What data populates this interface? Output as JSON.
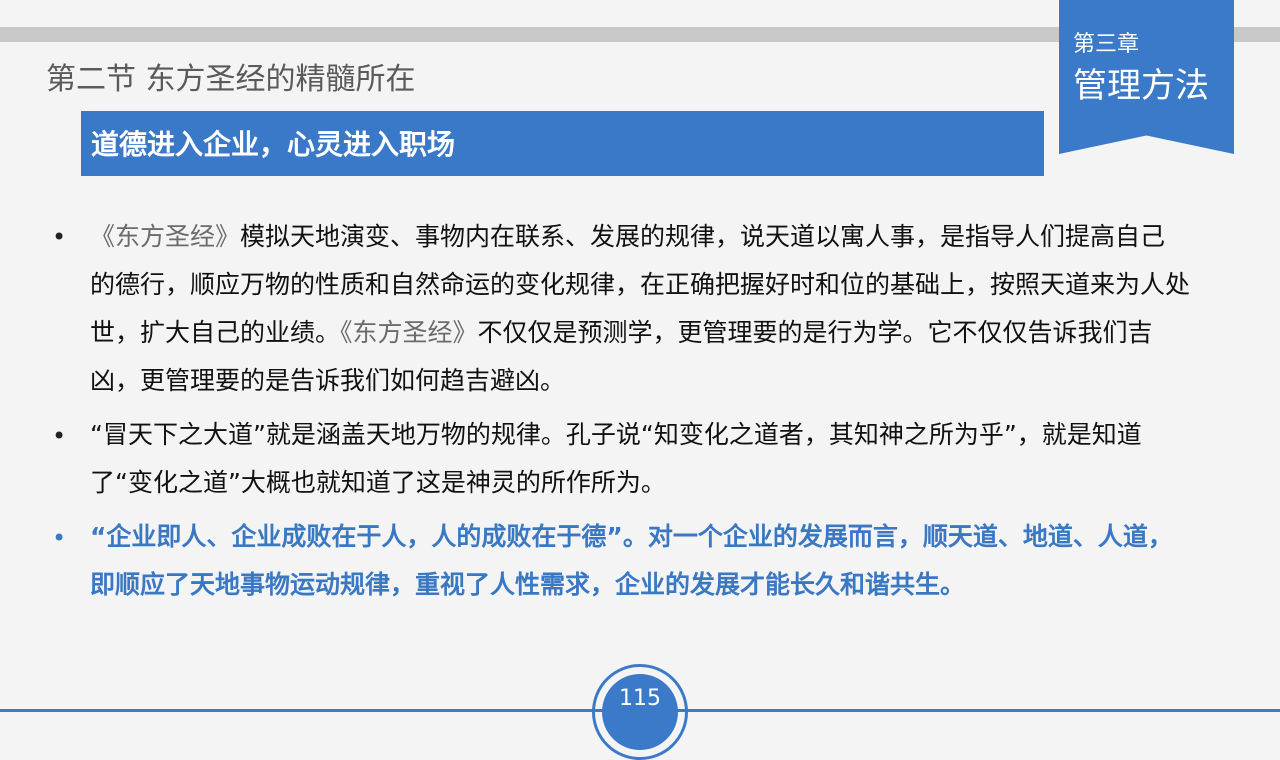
{
  "section_title": "第二节  东方圣经的精髓所在",
  "chapter": {
    "label": "第三章",
    "title": "管理方法"
  },
  "heading": "道德进入企业，心灵进入职场",
  "bullets": [
    {
      "parts": [
        {
          "text": "《东方圣经》",
          "style": "grey"
        },
        {
          "text": "模拟天地演变、事物内在联系、发展的规律，说天道以寓人事，是指导人们提高自己的德行，顺应万物的性质和自然命运的变化规律，在正确把握好时和位的基础上，按照天道来为人处世，扩大自己的业绩。",
          "style": "normal"
        },
        {
          "text": "《东方圣经》",
          "style": "grey"
        },
        {
          "text": "不仅仅是预测学，更管理要的是行为学。它不仅仅告诉我们吉凶，更管理要的是告诉我们如何趋吉避凶。",
          "style": "normal"
        }
      ]
    },
    {
      "parts": [
        {
          "text": "“冒天下之大道”就是涵盖天地万物的规律。孔子说“知变化之道者，其知神之所为乎”，就是知道了“变化之道”大概也就知道了这是神灵的所作所为。",
          "style": "normal"
        }
      ]
    },
    {
      "parts": [
        {
          "text": "“企业即人、企业成败在于人，人的成败在于德”。对一个企业的发展而言，顺天道、地道、人道，即顺应了天地事物运动规律，重视了人性需求，企业的发展才能长久和谐共生。",
          "style": "normal"
        }
      ]
    }
  ],
  "bullet_symbol": "•",
  "page_number": "115",
  "colors": {
    "accent": "#3b79c9",
    "highlight_text": "#3b78c4"
  }
}
